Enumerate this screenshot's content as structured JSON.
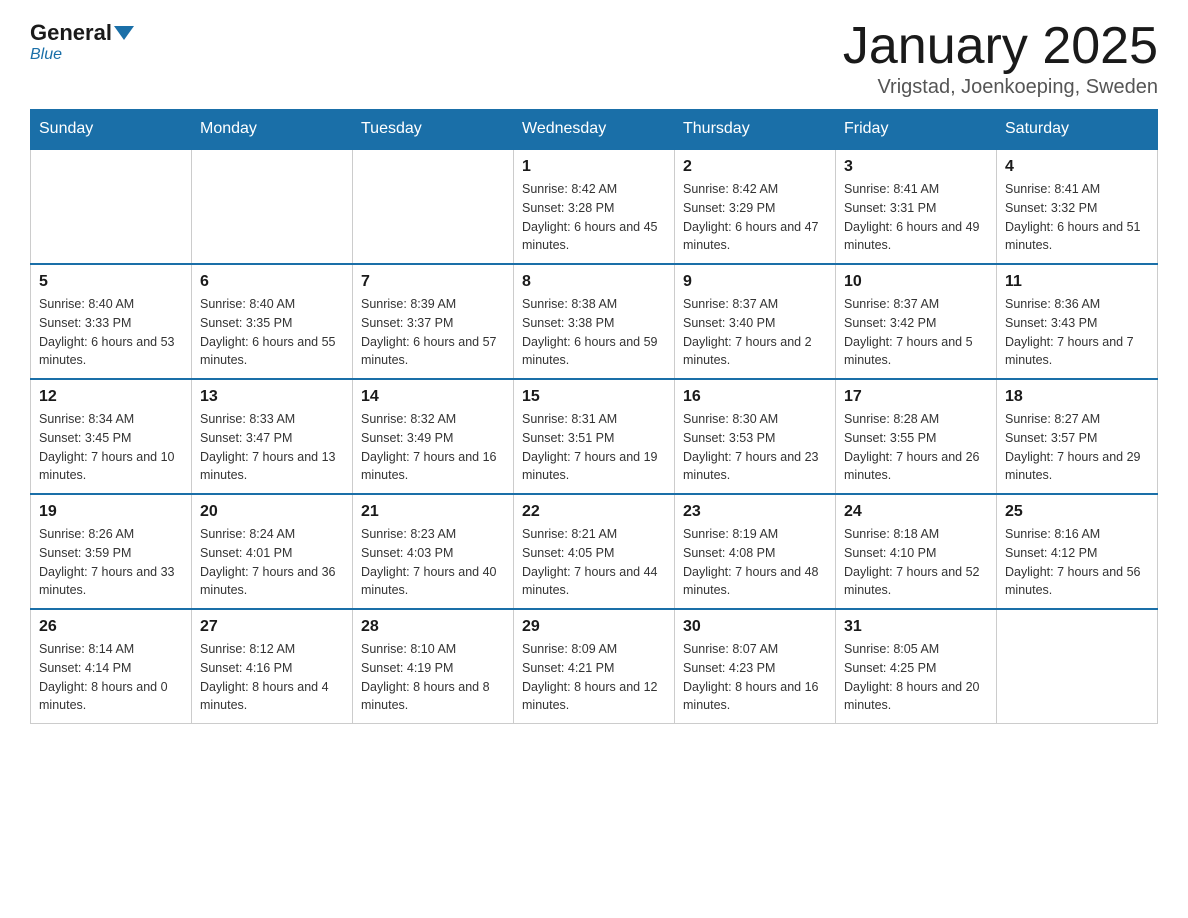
{
  "logo": {
    "general": "General",
    "blue": "Blue"
  },
  "title": "January 2025",
  "location": "Vrigstad, Joenkoeping, Sweden",
  "days_header": [
    "Sunday",
    "Monday",
    "Tuesday",
    "Wednesday",
    "Thursday",
    "Friday",
    "Saturday"
  ],
  "weeks": [
    [
      {
        "day": "",
        "info": ""
      },
      {
        "day": "",
        "info": ""
      },
      {
        "day": "",
        "info": ""
      },
      {
        "day": "1",
        "info": "Sunrise: 8:42 AM\nSunset: 3:28 PM\nDaylight: 6 hours and 45 minutes."
      },
      {
        "day": "2",
        "info": "Sunrise: 8:42 AM\nSunset: 3:29 PM\nDaylight: 6 hours and 47 minutes."
      },
      {
        "day": "3",
        "info": "Sunrise: 8:41 AM\nSunset: 3:31 PM\nDaylight: 6 hours and 49 minutes."
      },
      {
        "day": "4",
        "info": "Sunrise: 8:41 AM\nSunset: 3:32 PM\nDaylight: 6 hours and 51 minutes."
      }
    ],
    [
      {
        "day": "5",
        "info": "Sunrise: 8:40 AM\nSunset: 3:33 PM\nDaylight: 6 hours and 53 minutes."
      },
      {
        "day": "6",
        "info": "Sunrise: 8:40 AM\nSunset: 3:35 PM\nDaylight: 6 hours and 55 minutes."
      },
      {
        "day": "7",
        "info": "Sunrise: 8:39 AM\nSunset: 3:37 PM\nDaylight: 6 hours and 57 minutes."
      },
      {
        "day": "8",
        "info": "Sunrise: 8:38 AM\nSunset: 3:38 PM\nDaylight: 6 hours and 59 minutes."
      },
      {
        "day": "9",
        "info": "Sunrise: 8:37 AM\nSunset: 3:40 PM\nDaylight: 7 hours and 2 minutes."
      },
      {
        "day": "10",
        "info": "Sunrise: 8:37 AM\nSunset: 3:42 PM\nDaylight: 7 hours and 5 minutes."
      },
      {
        "day": "11",
        "info": "Sunrise: 8:36 AM\nSunset: 3:43 PM\nDaylight: 7 hours and 7 minutes."
      }
    ],
    [
      {
        "day": "12",
        "info": "Sunrise: 8:34 AM\nSunset: 3:45 PM\nDaylight: 7 hours and 10 minutes."
      },
      {
        "day": "13",
        "info": "Sunrise: 8:33 AM\nSunset: 3:47 PM\nDaylight: 7 hours and 13 minutes."
      },
      {
        "day": "14",
        "info": "Sunrise: 8:32 AM\nSunset: 3:49 PM\nDaylight: 7 hours and 16 minutes."
      },
      {
        "day": "15",
        "info": "Sunrise: 8:31 AM\nSunset: 3:51 PM\nDaylight: 7 hours and 19 minutes."
      },
      {
        "day": "16",
        "info": "Sunrise: 8:30 AM\nSunset: 3:53 PM\nDaylight: 7 hours and 23 minutes."
      },
      {
        "day": "17",
        "info": "Sunrise: 8:28 AM\nSunset: 3:55 PM\nDaylight: 7 hours and 26 minutes."
      },
      {
        "day": "18",
        "info": "Sunrise: 8:27 AM\nSunset: 3:57 PM\nDaylight: 7 hours and 29 minutes."
      }
    ],
    [
      {
        "day": "19",
        "info": "Sunrise: 8:26 AM\nSunset: 3:59 PM\nDaylight: 7 hours and 33 minutes."
      },
      {
        "day": "20",
        "info": "Sunrise: 8:24 AM\nSunset: 4:01 PM\nDaylight: 7 hours and 36 minutes."
      },
      {
        "day": "21",
        "info": "Sunrise: 8:23 AM\nSunset: 4:03 PM\nDaylight: 7 hours and 40 minutes."
      },
      {
        "day": "22",
        "info": "Sunrise: 8:21 AM\nSunset: 4:05 PM\nDaylight: 7 hours and 44 minutes."
      },
      {
        "day": "23",
        "info": "Sunrise: 8:19 AM\nSunset: 4:08 PM\nDaylight: 7 hours and 48 minutes."
      },
      {
        "day": "24",
        "info": "Sunrise: 8:18 AM\nSunset: 4:10 PM\nDaylight: 7 hours and 52 minutes."
      },
      {
        "day": "25",
        "info": "Sunrise: 8:16 AM\nSunset: 4:12 PM\nDaylight: 7 hours and 56 minutes."
      }
    ],
    [
      {
        "day": "26",
        "info": "Sunrise: 8:14 AM\nSunset: 4:14 PM\nDaylight: 8 hours and 0 minutes."
      },
      {
        "day": "27",
        "info": "Sunrise: 8:12 AM\nSunset: 4:16 PM\nDaylight: 8 hours and 4 minutes."
      },
      {
        "day": "28",
        "info": "Sunrise: 8:10 AM\nSunset: 4:19 PM\nDaylight: 8 hours and 8 minutes."
      },
      {
        "day": "29",
        "info": "Sunrise: 8:09 AM\nSunset: 4:21 PM\nDaylight: 8 hours and 12 minutes."
      },
      {
        "day": "30",
        "info": "Sunrise: 8:07 AM\nSunset: 4:23 PM\nDaylight: 8 hours and 16 minutes."
      },
      {
        "day": "31",
        "info": "Sunrise: 8:05 AM\nSunset: 4:25 PM\nDaylight: 8 hours and 20 minutes."
      },
      {
        "day": "",
        "info": ""
      }
    ]
  ]
}
